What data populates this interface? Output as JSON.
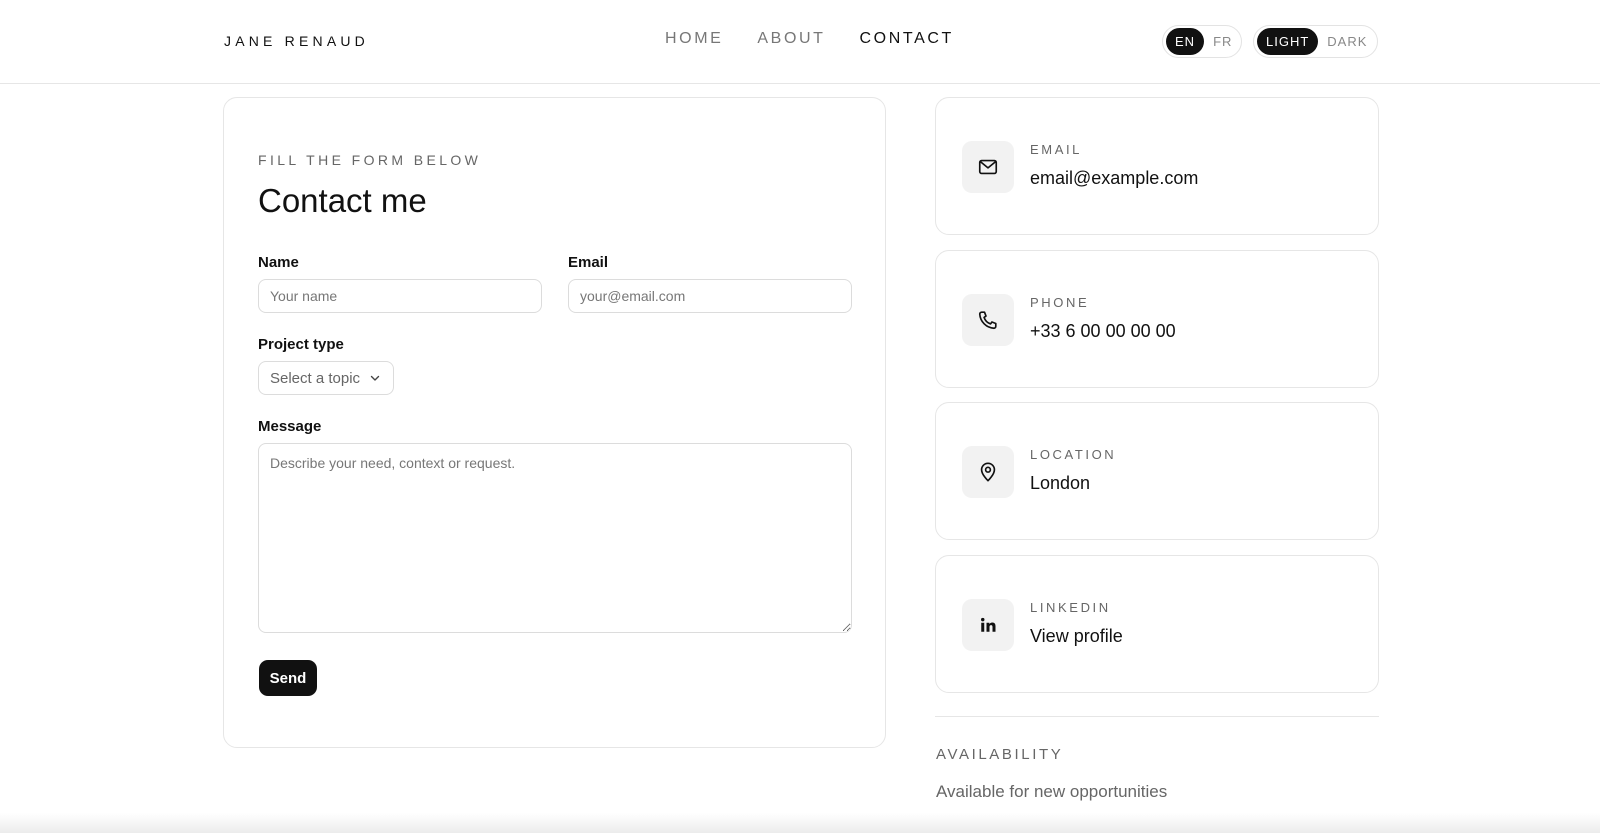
{
  "header": {
    "brand": "JANE RENAUD",
    "nav": [
      {
        "label": "HOME",
        "active": false
      },
      {
        "label": "ABOUT",
        "active": false
      },
      {
        "label": "CONTACT",
        "active": true
      }
    ],
    "language": {
      "options": [
        "EN",
        "FR"
      ],
      "selected": "EN"
    },
    "theme": {
      "options": [
        "LIGHT",
        "DARK"
      ],
      "selected": "LIGHT"
    }
  },
  "form": {
    "eyebrow": "FILL THE FORM BELOW",
    "title": "Contact me",
    "name": {
      "label": "Name",
      "placeholder": "Your name",
      "value": ""
    },
    "email": {
      "label": "Email",
      "placeholder": "your@email.com",
      "value": ""
    },
    "project_type": {
      "label": "Project type",
      "selected": "Select a topic"
    },
    "message": {
      "label": "Message",
      "placeholder": "Describe your need, context or request.",
      "value": ""
    },
    "send_label": "Send"
  },
  "contact_cards": [
    {
      "icon": "mail-icon",
      "label": "EMAIL",
      "value": "email@example.com"
    },
    {
      "icon": "phone-icon",
      "label": "PHONE",
      "value": "+33 6 00 00 00 00"
    },
    {
      "icon": "location-pin-icon",
      "label": "LOCATION",
      "value": "London"
    },
    {
      "icon": "linkedin-icon",
      "label": "LINKEDIN",
      "value": "View profile"
    }
  ],
  "availability": {
    "label": "AVAILABILITY",
    "text": "Available for new opportunities"
  },
  "colors": {
    "accent": "#111111",
    "border": "#e6e6e6",
    "muted": "#666666",
    "icon_bg": "#f2f2f2"
  }
}
